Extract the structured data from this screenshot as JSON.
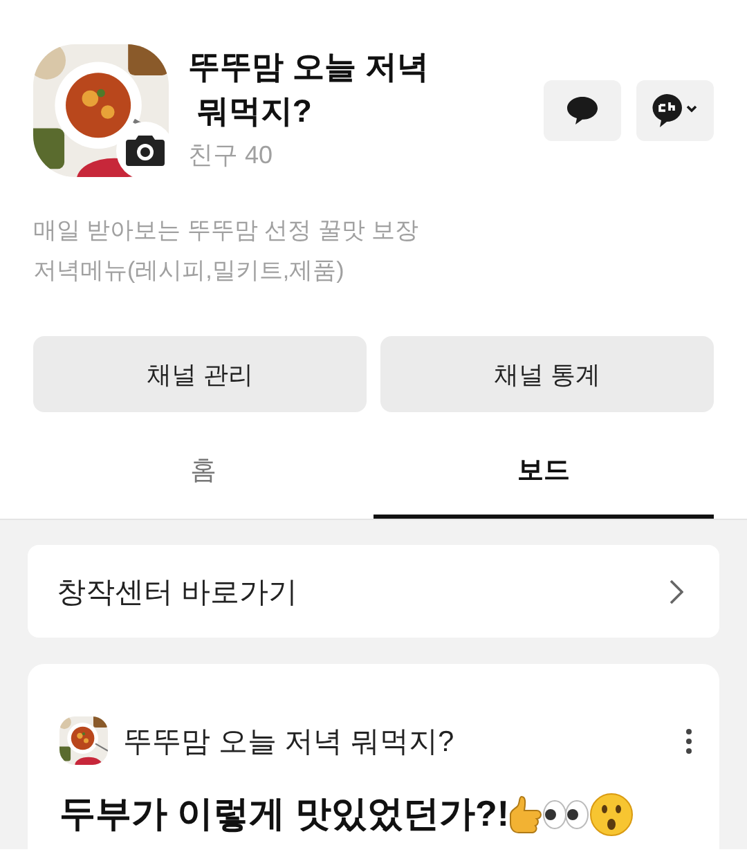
{
  "profile": {
    "name": "뚜뚜맘 오늘 저녁\n 뭐먹지?",
    "friends": "친구 40",
    "description": "매일 받아보는 뚜뚜맘 선정 꿀맛 보장\n저녁메뉴(레시피,밀키트,제품)"
  },
  "actions": [
    {
      "label": "채널 관리"
    },
    {
      "label": "채널 통계"
    }
  ],
  "tabs": [
    {
      "label": "홈",
      "selected": false
    },
    {
      "label": "보드",
      "selected": true
    }
  ],
  "shortcut": {
    "label": "창작센터 바로가기"
  },
  "post": {
    "author": "뚜뚜맘 오늘 저녁 뭐먹지?",
    "title": "두부가 이렇게 맛있었던가?!"
  }
}
